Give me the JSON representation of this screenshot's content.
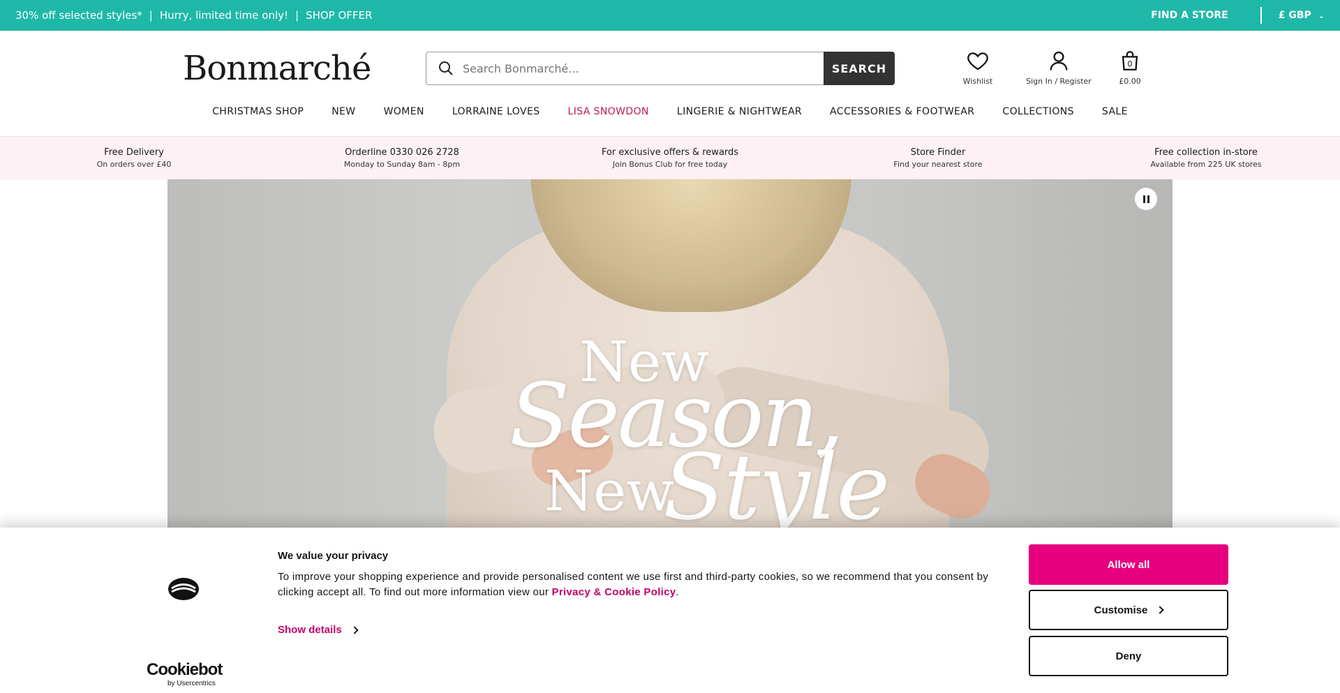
{
  "promo": {
    "offer": "30% off selected styles*",
    "hurry": "Hurry, limited time only!",
    "shop_offer": "SHOP OFFER",
    "find_store": "FIND A STORE",
    "currency": "£ GBP"
  },
  "header": {
    "logo": "Bonmarché",
    "search_placeholder": "Search Bonmarché...",
    "search_button": "SEARCH",
    "wishlist": "Wishlist",
    "account": "Sign In / Register",
    "bag_count": "0",
    "bag_total": "£0.00"
  },
  "nav": [
    {
      "label": "CHRISTMAS SHOP"
    },
    {
      "label": "NEW"
    },
    {
      "label": "WOMEN"
    },
    {
      "label": "LORRAINE LOVES"
    },
    {
      "label": "LISA SNOWDON"
    },
    {
      "label": "LINGERIE & NIGHTWEAR"
    },
    {
      "label": "ACCESSORIES & FOOTWEAR"
    },
    {
      "label": "COLLECTIONS"
    },
    {
      "label": "SALE"
    }
  ],
  "usps": [
    {
      "title": "Free Delivery",
      "sub": "On orders over £40"
    },
    {
      "title": "Orderline 0330 026 2728",
      "sub": "Monday to Sunday 8am - 8pm"
    },
    {
      "title": "For exclusive offers & rewards",
      "sub": "Join Bonus Club for free today"
    },
    {
      "title": "Store Finder",
      "sub": "Find your nearest store"
    },
    {
      "title": "Free collection in-store",
      "sub": "Available from 225 UK stores"
    }
  ],
  "hero": {
    "line1": "New",
    "line2": "Season,",
    "line3": "New",
    "line4": "Style"
  },
  "cookie": {
    "title": "We value your privacy",
    "body": "To improve your shopping experience and provide personalised content we use first and third-party cookies, so we recommend that you consent by clicking accept all. To find out more information view our",
    "policy_link": "Privacy & Cookie Policy",
    "period": ".",
    "show_details": "Show details",
    "allow_all": "Allow all",
    "customise": "Customise",
    "deny": "Deny",
    "brand": "Cookiebot",
    "brand_sub": "by Usercentrics"
  },
  "colors": {
    "promo_bg": "#1fb8a8",
    "accent_pink": "#e6007e",
    "nav_highlight": "#c2185b"
  }
}
